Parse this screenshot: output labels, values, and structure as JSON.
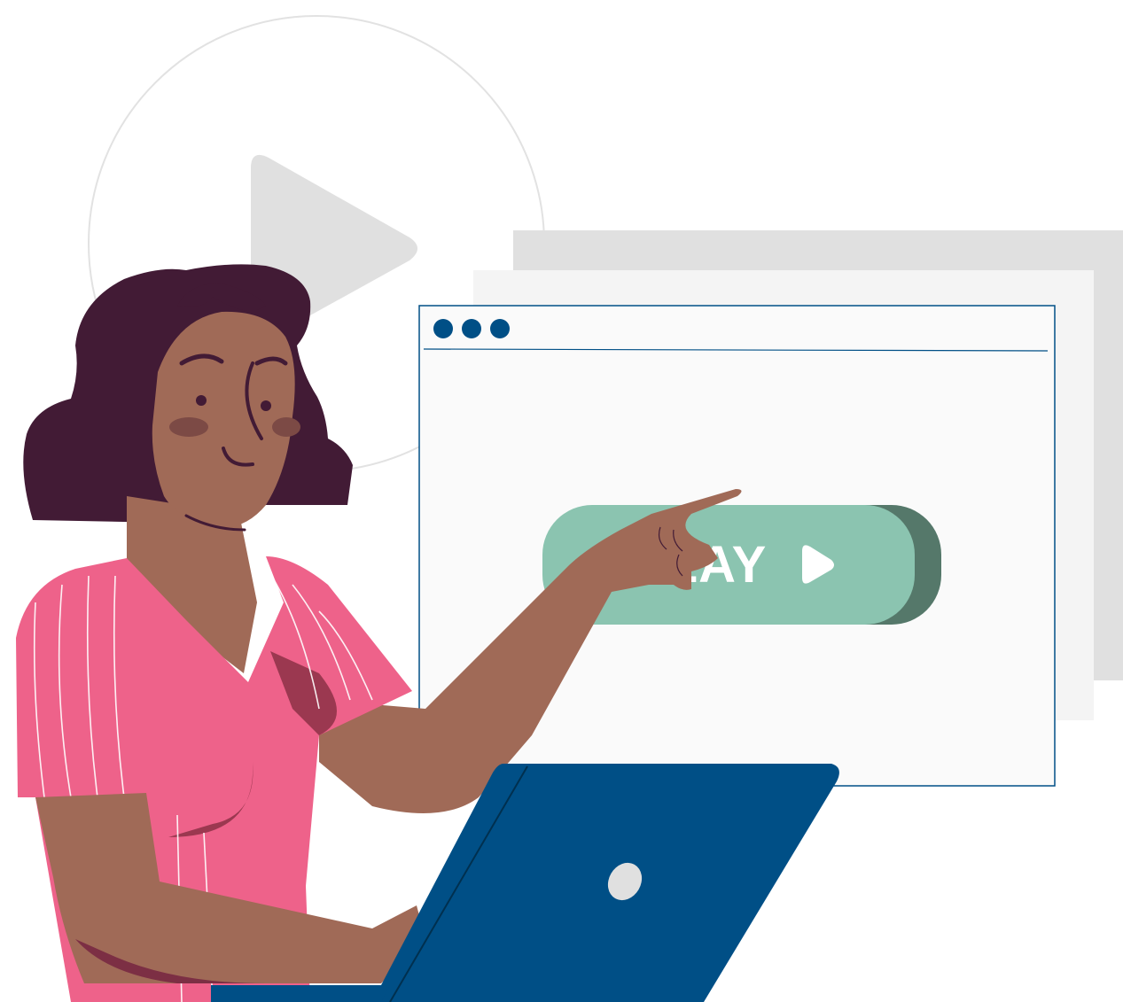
{
  "play_button": {
    "label": "PLAY"
  },
  "window": {
    "dots": [
      "window-dot-1",
      "window-dot-2",
      "window-dot-3"
    ]
  },
  "icons": {
    "background": "play-circle-icon",
    "button": "play-triangle-icon",
    "laptop": "laptop-logo-icon"
  },
  "colors": {
    "accent_green": "#8BC4B0",
    "accent_green_dark": "#55786A",
    "navy": "#004F86",
    "pink_shirt": "#EE628A",
    "hair": "#421B35",
    "skin": "#A06A57",
    "panel_gray": "#E0E0E0",
    "panel_light": "#F4F4F4",
    "window_bg": "#FAFAFA"
  }
}
